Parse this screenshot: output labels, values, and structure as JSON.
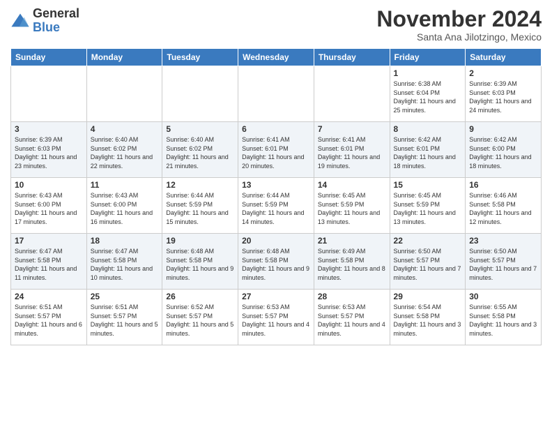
{
  "logo": {
    "general": "General",
    "blue": "Blue"
  },
  "header": {
    "month": "November 2024",
    "location": "Santa Ana Jilotzingo, Mexico"
  },
  "weekdays": [
    "Sunday",
    "Monday",
    "Tuesday",
    "Wednesday",
    "Thursday",
    "Friday",
    "Saturday"
  ],
  "weeks": [
    [
      {
        "day": "",
        "info": ""
      },
      {
        "day": "",
        "info": ""
      },
      {
        "day": "",
        "info": ""
      },
      {
        "day": "",
        "info": ""
      },
      {
        "day": "",
        "info": ""
      },
      {
        "day": "1",
        "info": "Sunrise: 6:38 AM\nSunset: 6:04 PM\nDaylight: 11 hours and 25 minutes."
      },
      {
        "day": "2",
        "info": "Sunrise: 6:39 AM\nSunset: 6:03 PM\nDaylight: 11 hours and 24 minutes."
      }
    ],
    [
      {
        "day": "3",
        "info": "Sunrise: 6:39 AM\nSunset: 6:03 PM\nDaylight: 11 hours and 23 minutes."
      },
      {
        "day": "4",
        "info": "Sunrise: 6:40 AM\nSunset: 6:02 PM\nDaylight: 11 hours and 22 minutes."
      },
      {
        "day": "5",
        "info": "Sunrise: 6:40 AM\nSunset: 6:02 PM\nDaylight: 11 hours and 21 minutes."
      },
      {
        "day": "6",
        "info": "Sunrise: 6:41 AM\nSunset: 6:01 PM\nDaylight: 11 hours and 20 minutes."
      },
      {
        "day": "7",
        "info": "Sunrise: 6:41 AM\nSunset: 6:01 PM\nDaylight: 11 hours and 19 minutes."
      },
      {
        "day": "8",
        "info": "Sunrise: 6:42 AM\nSunset: 6:01 PM\nDaylight: 11 hours and 18 minutes."
      },
      {
        "day": "9",
        "info": "Sunrise: 6:42 AM\nSunset: 6:00 PM\nDaylight: 11 hours and 18 minutes."
      }
    ],
    [
      {
        "day": "10",
        "info": "Sunrise: 6:43 AM\nSunset: 6:00 PM\nDaylight: 11 hours and 17 minutes."
      },
      {
        "day": "11",
        "info": "Sunrise: 6:43 AM\nSunset: 6:00 PM\nDaylight: 11 hours and 16 minutes."
      },
      {
        "day": "12",
        "info": "Sunrise: 6:44 AM\nSunset: 5:59 PM\nDaylight: 11 hours and 15 minutes."
      },
      {
        "day": "13",
        "info": "Sunrise: 6:44 AM\nSunset: 5:59 PM\nDaylight: 11 hours and 14 minutes."
      },
      {
        "day": "14",
        "info": "Sunrise: 6:45 AM\nSunset: 5:59 PM\nDaylight: 11 hours and 13 minutes."
      },
      {
        "day": "15",
        "info": "Sunrise: 6:45 AM\nSunset: 5:59 PM\nDaylight: 11 hours and 13 minutes."
      },
      {
        "day": "16",
        "info": "Sunrise: 6:46 AM\nSunset: 5:58 PM\nDaylight: 11 hours and 12 minutes."
      }
    ],
    [
      {
        "day": "17",
        "info": "Sunrise: 6:47 AM\nSunset: 5:58 PM\nDaylight: 11 hours and 11 minutes."
      },
      {
        "day": "18",
        "info": "Sunrise: 6:47 AM\nSunset: 5:58 PM\nDaylight: 11 hours and 10 minutes."
      },
      {
        "day": "19",
        "info": "Sunrise: 6:48 AM\nSunset: 5:58 PM\nDaylight: 11 hours and 9 minutes."
      },
      {
        "day": "20",
        "info": "Sunrise: 6:48 AM\nSunset: 5:58 PM\nDaylight: 11 hours and 9 minutes."
      },
      {
        "day": "21",
        "info": "Sunrise: 6:49 AM\nSunset: 5:58 PM\nDaylight: 11 hours and 8 minutes."
      },
      {
        "day": "22",
        "info": "Sunrise: 6:50 AM\nSunset: 5:57 PM\nDaylight: 11 hours and 7 minutes."
      },
      {
        "day": "23",
        "info": "Sunrise: 6:50 AM\nSunset: 5:57 PM\nDaylight: 11 hours and 7 minutes."
      }
    ],
    [
      {
        "day": "24",
        "info": "Sunrise: 6:51 AM\nSunset: 5:57 PM\nDaylight: 11 hours and 6 minutes."
      },
      {
        "day": "25",
        "info": "Sunrise: 6:51 AM\nSunset: 5:57 PM\nDaylight: 11 hours and 5 minutes."
      },
      {
        "day": "26",
        "info": "Sunrise: 6:52 AM\nSunset: 5:57 PM\nDaylight: 11 hours and 5 minutes."
      },
      {
        "day": "27",
        "info": "Sunrise: 6:53 AM\nSunset: 5:57 PM\nDaylight: 11 hours and 4 minutes."
      },
      {
        "day": "28",
        "info": "Sunrise: 6:53 AM\nSunset: 5:57 PM\nDaylight: 11 hours and 4 minutes."
      },
      {
        "day": "29",
        "info": "Sunrise: 6:54 AM\nSunset: 5:58 PM\nDaylight: 11 hours and 3 minutes."
      },
      {
        "day": "30",
        "info": "Sunrise: 6:55 AM\nSunset: 5:58 PM\nDaylight: 11 hours and 3 minutes."
      }
    ]
  ]
}
